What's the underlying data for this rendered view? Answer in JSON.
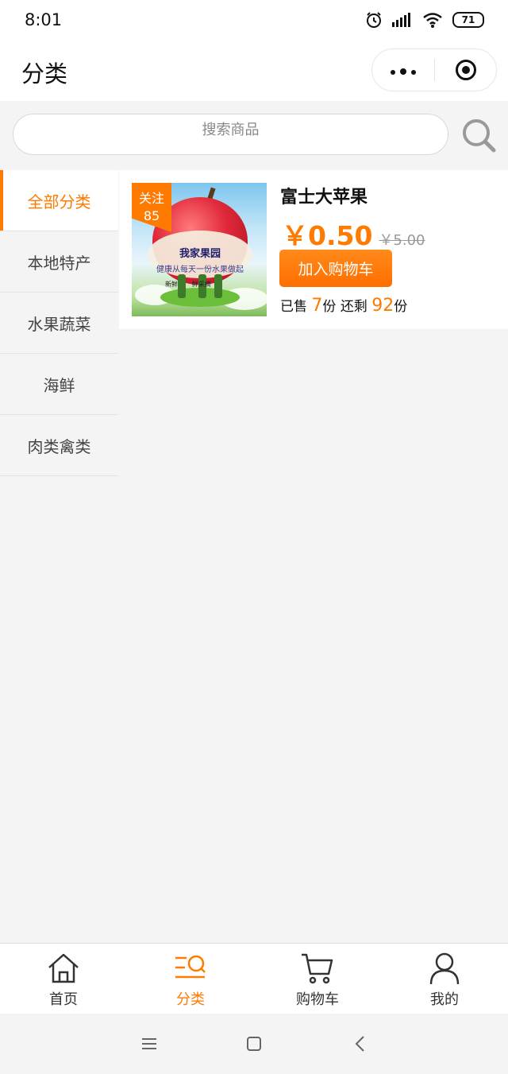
{
  "status": {
    "time": "8:01",
    "battery": "71"
  },
  "nav": {
    "title": "分类"
  },
  "search": {
    "placeholder": "搜索商品"
  },
  "categories": [
    {
      "label": "全部分类",
      "active": true
    },
    {
      "label": "本地特产",
      "active": false
    },
    {
      "label": "水果蔬菜",
      "active": false
    },
    {
      "label": "海鲜",
      "active": false
    },
    {
      "label": "肉类禽类",
      "active": false
    }
  ],
  "product": {
    "badge_label": "关注",
    "badge_count": "85",
    "image_text_1": "我家果园",
    "image_text_2": "健康从每天一份水果做起",
    "image_text_3": "新鲜       鲜采摘",
    "name": "富士大苹果",
    "price": "￥0.50",
    "old_price": "￥5.00",
    "cart_button": "加入购物车",
    "sold_label": "已售",
    "sold_count": "7",
    "sold_unit": "份",
    "remain_label": "还剩",
    "remain_count": "92",
    "remain_unit": "份"
  },
  "tabbar": {
    "items": [
      {
        "label": "首页",
        "icon": "home-icon",
        "active": false
      },
      {
        "label": "分类",
        "icon": "category-icon",
        "active": true
      },
      {
        "label": "购物车",
        "icon": "cart-icon",
        "active": false
      },
      {
        "label": "我的",
        "icon": "user-icon",
        "active": false
      }
    ]
  },
  "colors": {
    "accent": "#ff7a00",
    "background": "#f4f4f4"
  }
}
